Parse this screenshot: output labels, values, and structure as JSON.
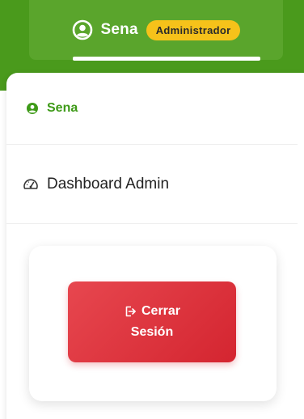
{
  "header": {
    "user_name": "Sena",
    "role_badge": "Administrador",
    "avatar_icon": "user-circle-icon"
  },
  "dropdown": {
    "profile_item": {
      "label": "Sena",
      "icon": "user-circle-icon"
    },
    "dashboard_item": {
      "label": "Dashboard Admin",
      "icon": "speedometer-icon"
    },
    "logout": {
      "label_line1": "Cerrar",
      "label_line2": "Sesión",
      "icon": "logout-icon"
    }
  },
  "colors": {
    "header_green": "#4a9a1c",
    "accent_green": "#3e9a18",
    "badge_yellow": "#f6c21a",
    "logout_red": "#d42530"
  }
}
